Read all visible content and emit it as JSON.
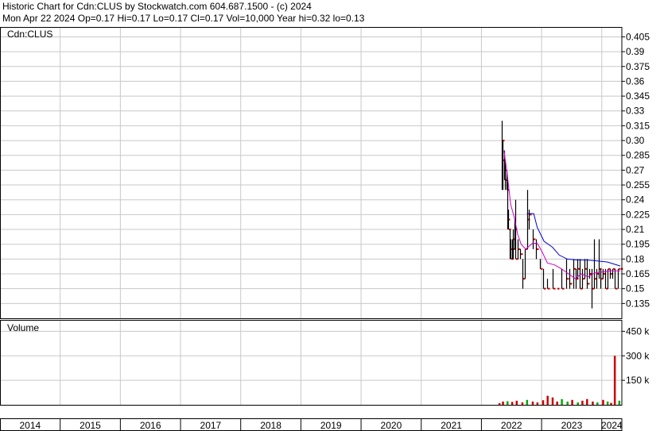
{
  "header": {
    "line1": "Historic Chart for Cdn:CLUS by Stockwatch.com 604.687.1500 - (c) 2024",
    "line2": "Mon Apr 22 2024  Op=0.17  Hi=0.17  Lo=0.17  Cl=0.17  Vol=10,000  Year hi=0.32  lo=0.13"
  },
  "chart_data": [
    {
      "type": "ohlc",
      "title": "Cdn:CLUS",
      "x_range": [
        "2014-01",
        "2024-05"
      ],
      "ylim": [
        0.12,
        0.415
      ],
      "y_ticks": [
        0.405,
        0.39,
        0.375,
        0.36,
        0.345,
        0.33,
        0.315,
        0.3,
        0.285,
        0.27,
        0.255,
        0.24,
        0.225,
        0.21,
        0.195,
        0.18,
        0.165,
        0.15,
        0.135
      ],
      "y_tick_labels": [
        "0.405",
        "0.39",
        "0.375",
        "0.36",
        "0.345",
        "0.33",
        "0.315",
        "0.30",
        "0.285",
        "0.27",
        "0.255",
        "0.24",
        "0.225",
        "0.21",
        "0.195",
        "0.18",
        "0.165",
        "0.15",
        "0.135"
      ],
      "x_tick_labels": [
        "2014",
        "2015",
        "2016",
        "2017",
        "2018",
        "2019",
        "2020",
        "2021",
        "2022",
        "2023",
        "2024"
      ],
      "grid": true,
      "colors": {
        "bar": "#000000",
        "close": "#cc0000",
        "ma_long": "#0000cc",
        "ma_short": "#cc00cc",
        "grid": "#c8c8c8"
      },
      "bars": [
        {
          "d": "2022-05-02",
          "h": 0.32,
          "l": 0.25,
          "c": 0.3
        },
        {
          "d": "2022-05-09",
          "h": 0.3,
          "l": 0.25,
          "c": 0.28
        },
        {
          "d": "2022-05-16",
          "h": 0.29,
          "l": 0.26,
          "c": 0.27
        },
        {
          "d": "2022-05-23",
          "h": 0.28,
          "l": 0.25,
          "c": 0.26
        },
        {
          "d": "2022-05-30",
          "h": 0.27,
          "l": 0.25,
          "c": 0.25
        },
        {
          "d": "2022-06-06",
          "h": 0.26,
          "l": 0.21,
          "c": 0.22
        },
        {
          "d": "2022-06-13",
          "h": 0.23,
          "l": 0.21,
          "c": 0.21
        },
        {
          "d": "2022-06-20",
          "h": 0.21,
          "l": 0.18,
          "c": 0.19
        },
        {
          "d": "2022-06-27",
          "h": 0.2,
          "l": 0.18,
          "c": 0.18
        },
        {
          "d": "2022-07-04",
          "h": 0.2,
          "l": 0.18,
          "c": 0.19
        },
        {
          "d": "2022-07-11",
          "h": 0.21,
          "l": 0.18,
          "c": 0.2
        },
        {
          "d": "2022-07-18",
          "h": 0.22,
          "l": 0.19,
          "c": 0.21
        },
        {
          "d": "2022-07-25",
          "h": 0.24,
          "l": 0.18,
          "c": 0.18
        },
        {
          "d": "2022-08-08",
          "h": 0.2,
          "l": 0.18,
          "c": 0.19
        },
        {
          "d": "2022-08-22",
          "h": 0.19,
          "l": 0.18,
          "c": 0.185
        },
        {
          "d": "2022-09-05",
          "h": 0.18,
          "l": 0.15,
          "c": 0.16
        },
        {
          "d": "2022-09-19",
          "h": 0.19,
          "l": 0.16,
          "c": 0.19
        },
        {
          "d": "2022-10-03",
          "h": 0.25,
          "l": 0.19,
          "c": 0.22
        },
        {
          "d": "2022-10-17",
          "h": 0.23,
          "l": 0.21,
          "c": 0.225
        },
        {
          "d": "2022-11-07",
          "h": 0.21,
          "l": 0.19,
          "c": 0.2
        },
        {
          "d": "2022-11-28",
          "h": 0.2,
          "l": 0.18,
          "c": 0.19
        },
        {
          "d": "2022-12-19",
          "h": 0.18,
          "l": 0.17,
          "c": 0.17
        },
        {
          "d": "2023-01-09",
          "h": 0.17,
          "l": 0.15,
          "c": 0.15
        },
        {
          "d": "2023-02-06",
          "h": 0.16,
          "l": 0.15,
          "c": 0.15
        },
        {
          "d": "2023-03-06",
          "h": 0.17,
          "l": 0.15,
          "c": 0.15
        },
        {
          "d": "2023-04-03",
          "h": 0.15,
          "l": 0.15,
          "c": 0.15
        },
        {
          "d": "2023-05-01",
          "h": 0.17,
          "l": 0.15,
          "c": 0.15
        },
        {
          "d": "2023-05-29",
          "h": 0.18,
          "l": 0.15,
          "c": 0.16
        },
        {
          "d": "2023-06-19",
          "h": 0.17,
          "l": 0.15,
          "c": 0.155
        },
        {
          "d": "2023-07-10",
          "h": 0.18,
          "l": 0.15,
          "c": 0.17
        },
        {
          "d": "2023-07-24",
          "h": 0.17,
          "l": 0.15,
          "c": 0.16
        },
        {
          "d": "2023-08-07",
          "h": 0.18,
          "l": 0.16,
          "c": 0.17
        },
        {
          "d": "2023-08-21",
          "h": 0.18,
          "l": 0.15,
          "c": 0.15
        },
        {
          "d": "2023-09-04",
          "h": 0.17,
          "l": 0.15,
          "c": 0.16
        },
        {
          "d": "2023-09-18",
          "h": 0.18,
          "l": 0.16,
          "c": 0.17
        },
        {
          "d": "2023-10-02",
          "h": 0.18,
          "l": 0.15,
          "c": 0.155
        },
        {
          "d": "2023-10-16",
          "h": 0.17,
          "l": 0.16,
          "c": 0.165
        },
        {
          "d": "2023-10-30",
          "h": 0.17,
          "l": 0.13,
          "c": 0.15
        },
        {
          "d": "2023-11-13",
          "h": 0.2,
          "l": 0.15,
          "c": 0.16
        },
        {
          "d": "2023-11-27",
          "h": 0.17,
          "l": 0.15,
          "c": 0.165
        },
        {
          "d": "2023-12-11",
          "h": 0.2,
          "l": 0.16,
          "c": 0.17
        },
        {
          "d": "2023-12-25",
          "h": 0.17,
          "l": 0.15,
          "c": 0.16
        },
        {
          "d": "2024-01-08",
          "h": 0.17,
          "l": 0.16,
          "c": 0.165
        },
        {
          "d": "2024-01-22",
          "h": 0.17,
          "l": 0.15,
          "c": 0.15
        },
        {
          "d": "2024-02-05",
          "h": 0.17,
          "l": 0.15,
          "c": 0.17
        },
        {
          "d": "2024-02-19",
          "h": 0.17,
          "l": 0.16,
          "c": 0.165
        },
        {
          "d": "2024-03-04",
          "h": 0.17,
          "l": 0.16,
          "c": 0.17
        },
        {
          "d": "2024-03-18",
          "h": 0.17,
          "l": 0.15,
          "c": 0.15
        },
        {
          "d": "2024-04-08",
          "h": 0.17,
          "l": 0.15,
          "c": 0.17
        },
        {
          "d": "2024-04-22",
          "h": 0.17,
          "l": 0.17,
          "c": 0.17
        }
      ],
      "ma_long": [
        {
          "d": "2022-10-03",
          "v": 0.226
        },
        {
          "d": "2022-11-14",
          "v": 0.226
        },
        {
          "d": "2022-12-05",
          "v": 0.212
        },
        {
          "d": "2023-01-16",
          "v": 0.198
        },
        {
          "d": "2023-03-06",
          "v": 0.192
        },
        {
          "d": "2023-04-17",
          "v": 0.184
        },
        {
          "d": "2023-06-05",
          "v": 0.18
        },
        {
          "d": "2023-08-07",
          "v": 0.179
        },
        {
          "d": "2023-10-02",
          "v": 0.179
        },
        {
          "d": "2023-12-04",
          "v": 0.178
        },
        {
          "d": "2024-02-05",
          "v": 0.177
        },
        {
          "d": "2024-04-22",
          "v": 0.173
        }
      ],
      "ma_short": [
        {
          "d": "2022-05-16",
          "v": 0.29
        },
        {
          "d": "2022-06-06",
          "v": 0.265
        },
        {
          "d": "2022-06-27",
          "v": 0.235
        },
        {
          "d": "2022-07-18",
          "v": 0.222
        },
        {
          "d": "2022-08-08",
          "v": 0.205
        },
        {
          "d": "2022-08-29",
          "v": 0.195
        },
        {
          "d": "2022-09-26",
          "v": 0.19
        },
        {
          "d": "2022-11-07",
          "v": 0.196
        },
        {
          "d": "2022-12-05",
          "v": 0.196
        },
        {
          "d": "2023-01-02",
          "v": 0.188
        },
        {
          "d": "2023-02-06",
          "v": 0.176
        },
        {
          "d": "2023-03-20",
          "v": 0.174
        },
        {
          "d": "2023-05-01",
          "v": 0.17
        },
        {
          "d": "2023-06-12",
          "v": 0.165
        },
        {
          "d": "2023-07-24",
          "v": 0.16
        },
        {
          "d": "2023-08-28",
          "v": 0.165
        },
        {
          "d": "2023-10-09",
          "v": 0.162
        },
        {
          "d": "2023-11-20",
          "v": 0.166
        },
        {
          "d": "2024-01-08",
          "v": 0.167
        },
        {
          "d": "2024-02-19",
          "v": 0.168
        },
        {
          "d": "2024-04-22",
          "v": 0.168
        }
      ]
    },
    {
      "type": "bar",
      "title": "Volume",
      "ylim": [
        0,
        520000
      ],
      "y_ticks": [
        450000,
        300000,
        150000
      ],
      "y_tick_labels": [
        "450 k",
        "300 k",
        "150 k"
      ],
      "colors": {
        "up": "#00aa00",
        "down": "#cc0000"
      },
      "bars": [
        {
          "d": "2022-04-18",
          "v": 10000,
          "up": false
        },
        {
          "d": "2022-05-09",
          "v": 20000,
          "up": false
        },
        {
          "d": "2022-06-06",
          "v": 22000,
          "up": true
        },
        {
          "d": "2022-07-04",
          "v": 18000,
          "up": false
        },
        {
          "d": "2022-08-01",
          "v": 25000,
          "up": false
        },
        {
          "d": "2022-09-05",
          "v": 15000,
          "up": false
        },
        {
          "d": "2022-10-03",
          "v": 30000,
          "up": true
        },
        {
          "d": "2022-11-07",
          "v": 20000,
          "up": false
        },
        {
          "d": "2022-12-05",
          "v": 15000,
          "up": false
        },
        {
          "d": "2023-01-09",
          "v": 28000,
          "up": false
        },
        {
          "d": "2023-02-06",
          "v": 55000,
          "up": false
        },
        {
          "d": "2023-03-06",
          "v": 45000,
          "up": false
        },
        {
          "d": "2023-04-03",
          "v": 20000,
          "up": false
        },
        {
          "d": "2023-05-01",
          "v": 35000,
          "up": true
        },
        {
          "d": "2023-06-05",
          "v": 20000,
          "up": true
        },
        {
          "d": "2023-07-03",
          "v": 30000,
          "up": false
        },
        {
          "d": "2023-08-07",
          "v": 15000,
          "up": true
        },
        {
          "d": "2023-09-04",
          "v": 25000,
          "up": false
        },
        {
          "d": "2023-10-02",
          "v": 35000,
          "up": false
        },
        {
          "d": "2023-11-06",
          "v": 20000,
          "up": false
        },
        {
          "d": "2023-12-04",
          "v": 15000,
          "up": true
        },
        {
          "d": "2024-01-08",
          "v": 30000,
          "up": false
        },
        {
          "d": "2024-02-05",
          "v": 20000,
          "up": true
        },
        {
          "d": "2024-02-26",
          "v": 12000,
          "up": false
        },
        {
          "d": "2024-03-18",
          "v": 300000,
          "up": false
        },
        {
          "d": "2024-04-15",
          "v": 25000,
          "up": true
        }
      ]
    }
  ]
}
